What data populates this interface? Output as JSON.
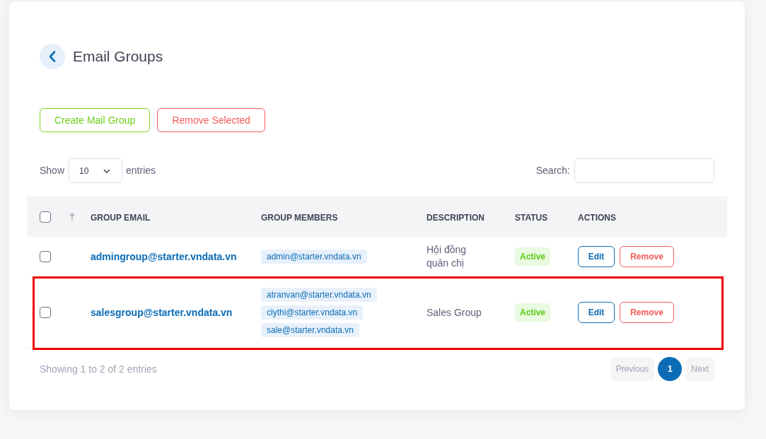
{
  "page": {
    "title": "Email Groups"
  },
  "toolbar": {
    "buttons": [
      {
        "label": "Create Mail Group",
        "kind": "create"
      },
      {
        "label": "Remove Selected",
        "kind": "remove"
      }
    ]
  },
  "length_menu": {
    "prefix": "Show",
    "value": "10",
    "suffix": "entries"
  },
  "search": {
    "label": "Search:"
  },
  "table": {
    "select_all": {
      "checked": false
    },
    "columns": [
      "GROUP EMAIL",
      "GROUP MEMBERS",
      "DESCRIPTION",
      "STATUS",
      "ACTIONS"
    ],
    "rows": [
      {
        "checked": false,
        "highlighted": false,
        "email": "admingroup@starter.vndata.vn",
        "members": [
          "admin@starter.vndata.vn"
        ],
        "description": "Hội đồng quản chị",
        "status": {
          "label": "Active",
          "kind": "active"
        },
        "actions": [
          {
            "label": "Edit",
            "kind": "edit"
          },
          {
            "label": "Remove",
            "kind": "remove"
          }
        ]
      },
      {
        "checked": false,
        "highlighted": true,
        "email": "salesgroup@starter.vndata.vn",
        "members": [
          "atranvan@starter.vndata.vn",
          "clythi@starter.vndata.vn",
          "sale@starter.vndata.vn"
        ],
        "description": "Sales Group",
        "status": {
          "label": "Active",
          "kind": "active"
        },
        "actions": [
          {
            "label": "Edit",
            "kind": "edit"
          },
          {
            "label": "Remove",
            "kind": "remove"
          }
        ]
      }
    ]
  },
  "footer": {
    "info": "Showing 1 to 2 of 2 entries",
    "pagination": {
      "previous": {
        "label": "Previous",
        "disabled": true
      },
      "pages": [
        {
          "label": "1",
          "selected": true
        }
      ],
      "next": {
        "label": "Next",
        "disabled": true
      }
    }
  }
}
